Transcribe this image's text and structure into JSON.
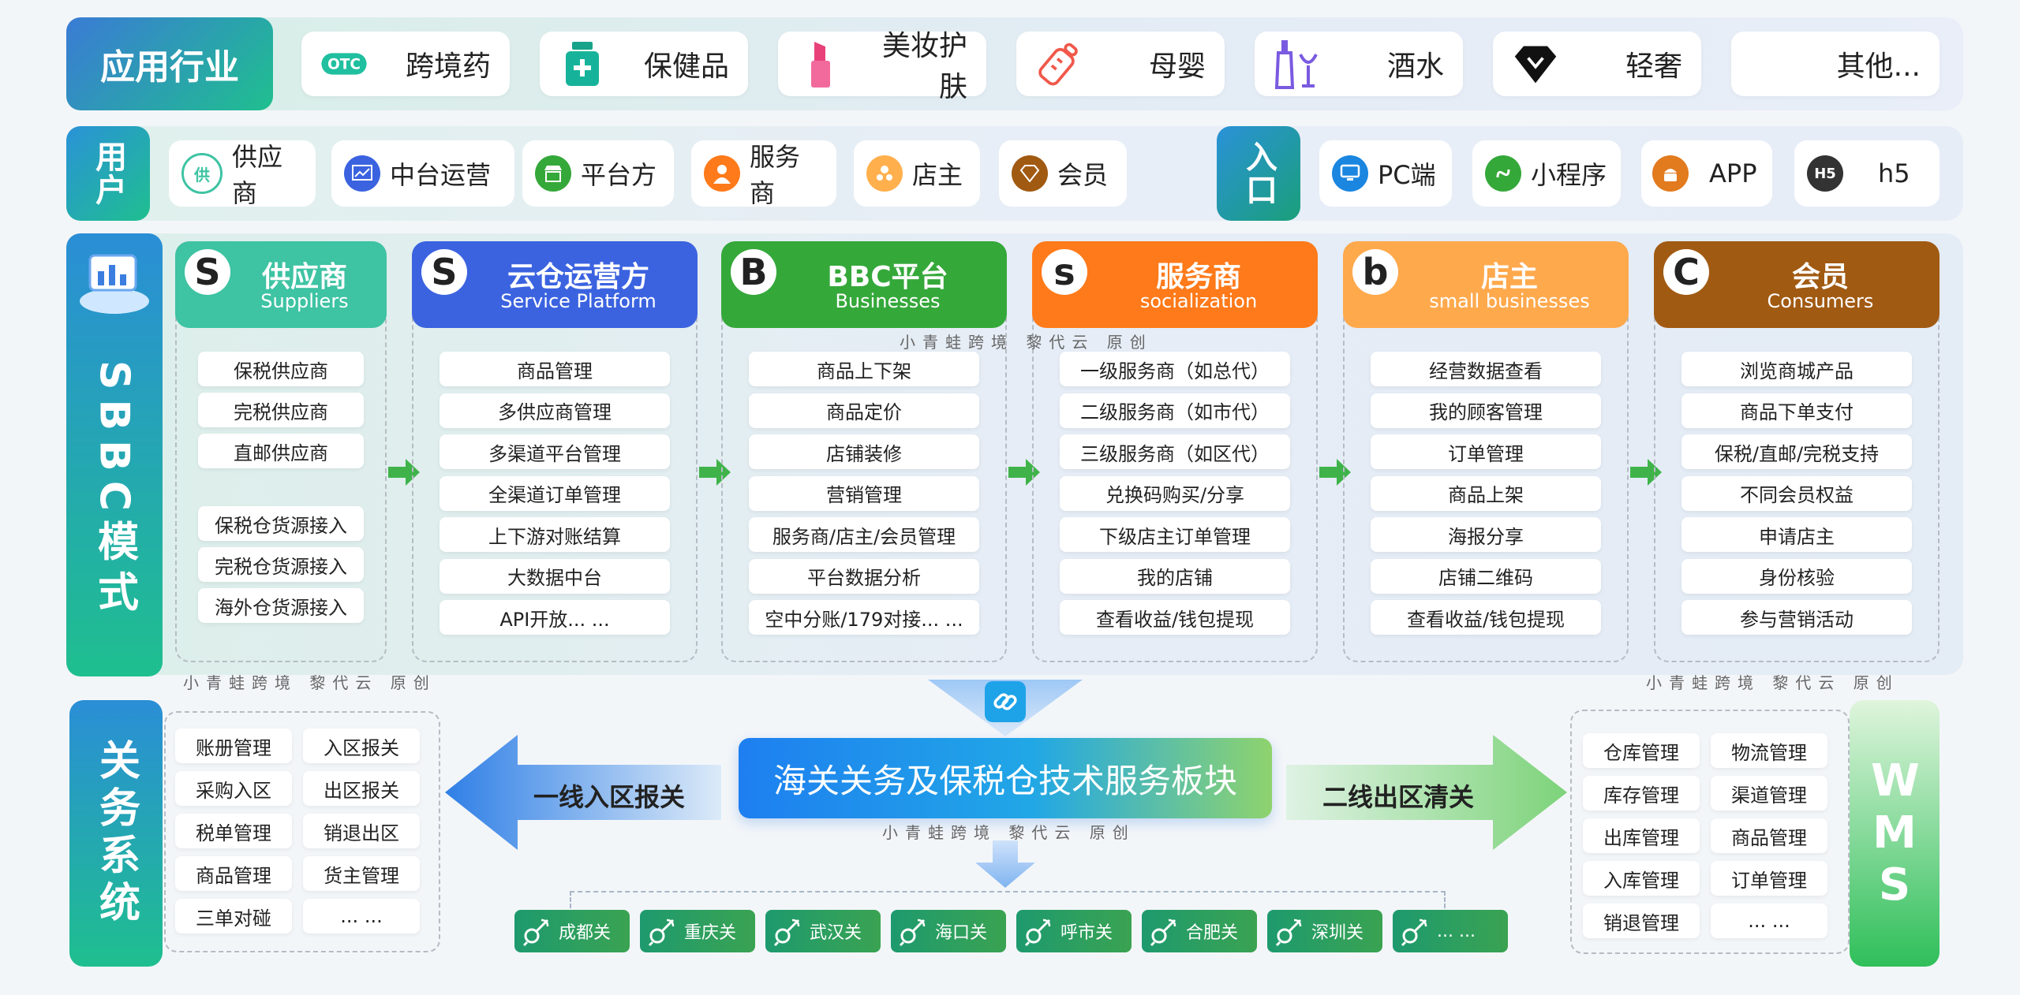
{
  "industry": {
    "label": "应用行业",
    "items": [
      {
        "name": "跨境药",
        "icon": "otc-icon",
        "badge": "OTC"
      },
      {
        "name": "保健品",
        "icon": "medicine-bottle-icon"
      },
      {
        "name": "美妆护肤",
        "icon": "lipstick-icon"
      },
      {
        "name": "母婴",
        "icon": "baby-bottle-icon"
      },
      {
        "name": "酒水",
        "icon": "wine-icon"
      },
      {
        "name": "轻奢",
        "icon": "diamond-icon"
      },
      {
        "name": "其他...",
        "icon": ""
      }
    ]
  },
  "users": {
    "label": "用户",
    "items": [
      {
        "name": "供应商",
        "icon": "supplier-icon",
        "glyph": "供"
      },
      {
        "name": "中台运营",
        "icon": "chart-icon"
      },
      {
        "name": "平台方",
        "icon": "shop-icon"
      },
      {
        "name": "服务商",
        "icon": "person-icon"
      },
      {
        "name": "店主",
        "icon": "shopkeeper-icon"
      },
      {
        "name": "会员",
        "icon": "diamond-icon"
      }
    ]
  },
  "entry": {
    "label": "入口",
    "items": [
      {
        "name": "PC端",
        "icon": "monitor-icon"
      },
      {
        "name": "小程序",
        "icon": "miniprogram-icon"
      },
      {
        "name": "APP",
        "icon": "android-icon"
      },
      {
        "name": "h5",
        "icon": "h5-icon",
        "badge": "H5"
      }
    ]
  },
  "sbbc": {
    "label": "SBBC模式",
    "columns": [
      {
        "letter": "S",
        "title": "供应商",
        "subtitle": "Suppliers",
        "color": "#3ec3a3",
        "items": [
          "保税供应商",
          "完税供应商",
          "直邮供应商",
          "保税仓货源接入",
          "完税仓货源接入",
          "海外仓货源接入"
        ]
      },
      {
        "letter": "S",
        "title": "云仓运营方",
        "subtitle": "Service Platform",
        "color": "#3b63e0",
        "items": [
          "商品管理",
          "多供应商管理",
          "多渠道平台管理",
          "全渠道订单管理",
          "上下游对账结算",
          "大数据中台",
          "API开放... ..."
        ]
      },
      {
        "letter": "B",
        "title": "BBC平台",
        "subtitle": "Businesses",
        "color": "#35a83a",
        "items": [
          "商品上下架",
          "商品定价",
          "店铺装修",
          "营销管理",
          "服务商/店主/会员管理",
          "平台数据分析",
          "空中分账/179对接... ..."
        ]
      },
      {
        "letter": "s",
        "title": "服务商",
        "subtitle": "socialization",
        "color": "#ff7a1a",
        "items": [
          "一级服务商（如总代）",
          "二级服务商（如市代）",
          "三级服务商（如区代）",
          "兑换码购买/分享",
          "下级店主订单管理",
          "我的店铺",
          "查看收益/钱包提现"
        ]
      },
      {
        "letter": "b",
        "title": "店主",
        "subtitle": "small businesses",
        "color": "#ffa94d",
        "items": [
          "经营数据查看",
          "我的顾客管理",
          "订单管理",
          "商品上架",
          "海报分享",
          "店铺二维码",
          "查看收益/钱包提现"
        ]
      },
      {
        "letter": "C",
        "title": "会员",
        "subtitle": "Consumers",
        "color": "#a15a12",
        "items": [
          "浏览商城产品",
          "商品下单支付",
          "保税/直邮/完税支持",
          "不同会员权益",
          "申请店主",
          "身份核验",
          "参与营销活动"
        ]
      }
    ]
  },
  "watermark": "小青蛙跨境 黎代云 原创",
  "customs": {
    "label": "关务系统",
    "items": [
      "账册管理",
      "入区报关",
      "采购入区",
      "出区报关",
      "税单管理",
      "销退出区",
      "商品管理",
      "货主管理",
      "三单对碰",
      "... ..."
    ]
  },
  "center": {
    "title": "海关关务及保税仓技术服务板块",
    "left_arrow": "一线入区报关",
    "right_arrow": "二线出区清关"
  },
  "ports": [
    "成都关",
    "重庆关",
    "武汉关",
    "海口关",
    "呼市关",
    "合肥关",
    "深圳关",
    "... ..."
  ],
  "wms": {
    "label": "WMS",
    "items": [
      "仓库管理",
      "物流管理",
      "库存管理",
      "渠道管理",
      "出库管理",
      "商品管理",
      "入库管理",
      "订单管理",
      "销退管理",
      "... ..."
    ]
  }
}
